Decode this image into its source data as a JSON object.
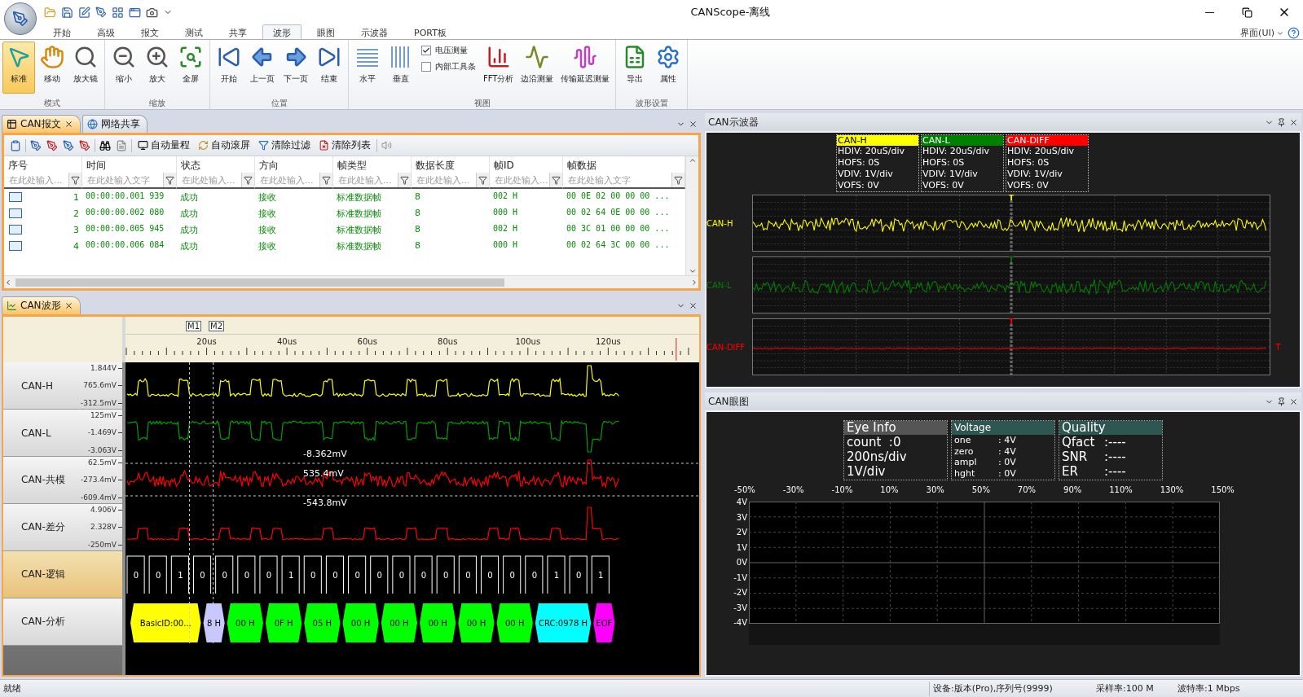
{
  "window": {
    "title": "CANScope-离线",
    "ui_menu": "界面(UI)"
  },
  "ribbon_tabs": [
    {
      "label": "开始",
      "selected": false
    },
    {
      "label": "高级",
      "selected": false
    },
    {
      "label": "报文",
      "selected": false
    },
    {
      "label": "测试",
      "selected": false
    },
    {
      "label": "共享",
      "selected": false
    },
    {
      "label": "波形",
      "selected": true
    },
    {
      "label": "眼图",
      "selected": false
    },
    {
      "label": "示波器",
      "selected": false
    },
    {
      "label": "PORT板",
      "selected": false
    }
  ],
  "ribbon_groups": [
    {
      "title": "模式",
      "items": [
        {
          "kind": "button",
          "label": "标准",
          "selected": true
        },
        {
          "kind": "button",
          "label": "移动",
          "selected": false
        },
        {
          "kind": "button",
          "label": "放大镜",
          "selected": false
        }
      ]
    },
    {
      "title": "缩放",
      "items": [
        {
          "kind": "button",
          "label": "缩小",
          "selected": false
        },
        {
          "kind": "button",
          "label": "放大",
          "selected": false
        },
        {
          "kind": "button",
          "label": "全屏",
          "selected": false
        }
      ]
    },
    {
      "title": "位置",
      "items": [
        {
          "kind": "button",
          "label": "开始",
          "selected": false
        },
        {
          "kind": "button",
          "label": "上一页",
          "selected": false
        },
        {
          "kind": "button",
          "label": "下一页",
          "selected": false
        },
        {
          "kind": "button",
          "label": "结束",
          "selected": false
        }
      ]
    },
    {
      "title": "视图",
      "items": [
        {
          "kind": "button",
          "label": "水平",
          "selected": false
        },
        {
          "kind": "button",
          "label": "垂直",
          "selected": false
        },
        {
          "kind": "checkbox",
          "label": "电压测量",
          "checked": true
        },
        {
          "kind": "checkbox",
          "label": "内部工具条",
          "checked": false
        },
        {
          "kind": "button",
          "label": "FFT分析",
          "selected": false
        },
        {
          "kind": "button",
          "label": "边沿测量",
          "selected": false
        },
        {
          "kind": "button",
          "label": "传输延迟测量",
          "selected": false
        }
      ]
    },
    {
      "title": "波形设置",
      "items": [
        {
          "kind": "button",
          "label": "导出",
          "selected": false
        },
        {
          "kind": "button",
          "label": "属性",
          "selected": false
        }
      ]
    }
  ],
  "message_panel": {
    "tabs": [
      {
        "label": "CAN报文",
        "selected": true
      },
      {
        "label": "网络共享",
        "selected": false
      }
    ],
    "toolbar": [
      "自动量程",
      "自动滚屏",
      "清除过滤",
      "清除列表"
    ],
    "columns": [
      "序号",
      "时间",
      "状态",
      "方向",
      "帧类型",
      "数据长度",
      "帧ID",
      "帧数据"
    ],
    "filters": [
      {
        "placeholder": "在此处输入..."
      },
      {
        "placeholder": "在此处输入文字"
      },
      {
        "placeholder": "在此处输入..."
      },
      {
        "placeholder": "在此处输入..."
      },
      {
        "placeholder": "在此处输入..."
      },
      {
        "placeholder": "在此处输入..."
      },
      {
        "placeholder": "在此处输入..."
      },
      {
        "placeholder": "在此处输入文字"
      }
    ],
    "rows": [
      [
        "1",
        "00:00:00.001 939",
        "成功",
        "接收",
        "标准数据帧",
        "8",
        "002 H",
        "00 0E 02 00 00 00 ..."
      ],
      [
        "2",
        "00:00:00.002 080",
        "成功",
        "接收",
        "标准数据帧",
        "8",
        "000 H",
        "00 02 64 0E 00 00 ..."
      ],
      [
        "3",
        "00:00:00.005 945",
        "成功",
        "接收",
        "标准数据帧",
        "8",
        "002 H",
        "00 3C 01 00 00 00 ..."
      ],
      [
        "4",
        "00:00:00.006 084",
        "成功",
        "接收",
        "标准数据帧",
        "8",
        "000 H",
        "00 02 64 3C 00 00 ..."
      ]
    ]
  },
  "waveform_panel": {
    "title": "CAN波形",
    "markers": [
      "M1",
      "M2"
    ],
    "ticks": [
      "20us",
      "40us",
      "60us",
      "80us",
      "100us",
      "120us"
    ],
    "channels": [
      {
        "kind": "analog",
        "name": "CAN-H",
        "color": "#ffff00",
        "selected": false,
        "scale": [
          "1.844V",
          "765.6mV",
          "-312.5mV"
        ]
      },
      {
        "kind": "analog",
        "name": "CAN-L",
        "color": "#00a000",
        "selected": false,
        "scale": [
          "125mV",
          "-1.469V",
          "-3.063V"
        ]
      },
      {
        "kind": "analog",
        "name": "CAN-共模",
        "color": "#ff0000",
        "selected": false,
        "scale": [
          "62.5mV",
          "-273.4mV",
          "-609.4mV"
        ],
        "readings": [
          "-8.362mV",
          "535.4mV",
          "-543.8mV"
        ]
      },
      {
        "kind": "analog",
        "name": "CAN-差分",
        "color": "#ff0000",
        "selected": false,
        "scale": [
          "4.906V",
          "2.328V",
          "-250mV"
        ]
      },
      {
        "kind": "logic",
        "name": "CAN-逻辑",
        "selected": true,
        "bits": [
          "0",
          "0",
          "1",
          "0",
          "0",
          "0",
          "0",
          "1",
          "0",
          "0",
          "0",
          "0",
          "0",
          "0",
          "0",
          "0",
          "0",
          "0",
          "0",
          "1",
          "0",
          "1"
        ]
      },
      {
        "kind": "frames",
        "name": "CAN-分析",
        "selected": false,
        "segments": [
          {
            "label": "BasicID:00...",
            "color": "#ffff00"
          },
          {
            "label": "8 H",
            "color": "#c8c8ff"
          },
          {
            "label": "00 H",
            "color": "#00ff00"
          },
          {
            "label": "0F H",
            "color": "#00ff00"
          },
          {
            "label": "05 H",
            "color": "#00ff00"
          },
          {
            "label": "00 H",
            "color": "#00ff00"
          },
          {
            "label": "00 H",
            "color": "#00ff00"
          },
          {
            "label": "00 H",
            "color": "#00ff00"
          },
          {
            "label": "00 H",
            "color": "#00ff00"
          },
          {
            "label": "00 H",
            "color": "#00ff00"
          },
          {
            "label": "CRC:0978 H",
            "color": "#00ffff"
          },
          {
            "label": "EOF",
            "color": "#ff00ff"
          }
        ]
      }
    ]
  },
  "scope_panel": {
    "title": "CAN示波器",
    "channels": [
      {
        "name": "CAN-H",
        "color": "#ffff00",
        "settings": [
          "HDIV: 20uS/div",
          "HOFS: 0S",
          "VDIV: 1V/div",
          "VOFS: 0V"
        ],
        "trace_label": "CAN-H",
        "trigger": "T"
      },
      {
        "name": "CAN-L",
        "color": "#008000",
        "settings": [
          "HDIV: 20uS/div",
          "HOFS: 0S",
          "VDIV: 1V/div",
          "VOFS: 0V"
        ],
        "trace_label": "CAN-L",
        "trigger": "T"
      },
      {
        "name": "CAN-DIFF",
        "color": "#ff0000",
        "settings": [
          "HDIV: 20uS/div",
          "HOFS: 0S",
          "VDIV: 1V/div",
          "VOFS: 0V"
        ],
        "trace_label": "CAN-DIFF",
        "trigger": "T",
        "level_mark": "T"
      }
    ]
  },
  "eye_panel": {
    "title": "CAN眼图",
    "eye_info": {
      "title": "Eye Info",
      "lines": [
        "count  :0",
        "200ns/div",
        "1V/div"
      ]
    },
    "voltage": {
      "title": "Voltage",
      "rows": [
        [
          "one",
          ": 4V"
        ],
        [
          "zero",
          ": 4V"
        ],
        [
          "ampl",
          ": 0V"
        ],
        [
          "hght",
          ": 0V"
        ]
      ]
    },
    "quality": {
      "title": "Quality",
      "rows": [
        [
          "Qfact",
          ":----"
        ],
        [
          "SNR",
          ":----"
        ],
        [
          "ER",
          ":----"
        ]
      ]
    },
    "x_labels": [
      "-50%",
      "-30%",
      "-10%",
      "10%",
      "30%",
      "50%",
      "70%",
      "90%",
      "110%",
      "130%",
      "150%"
    ],
    "y_labels": [
      "4V",
      "3V",
      "2V",
      "1V",
      "0V",
      "-1V",
      "-2V",
      "-3V",
      "-4V"
    ]
  },
  "status_bar": [
    "就绪",
    "设备:版本(Pro),序列号(9999)",
    "采样率:100 M",
    "波特率:1 Mbps"
  ]
}
